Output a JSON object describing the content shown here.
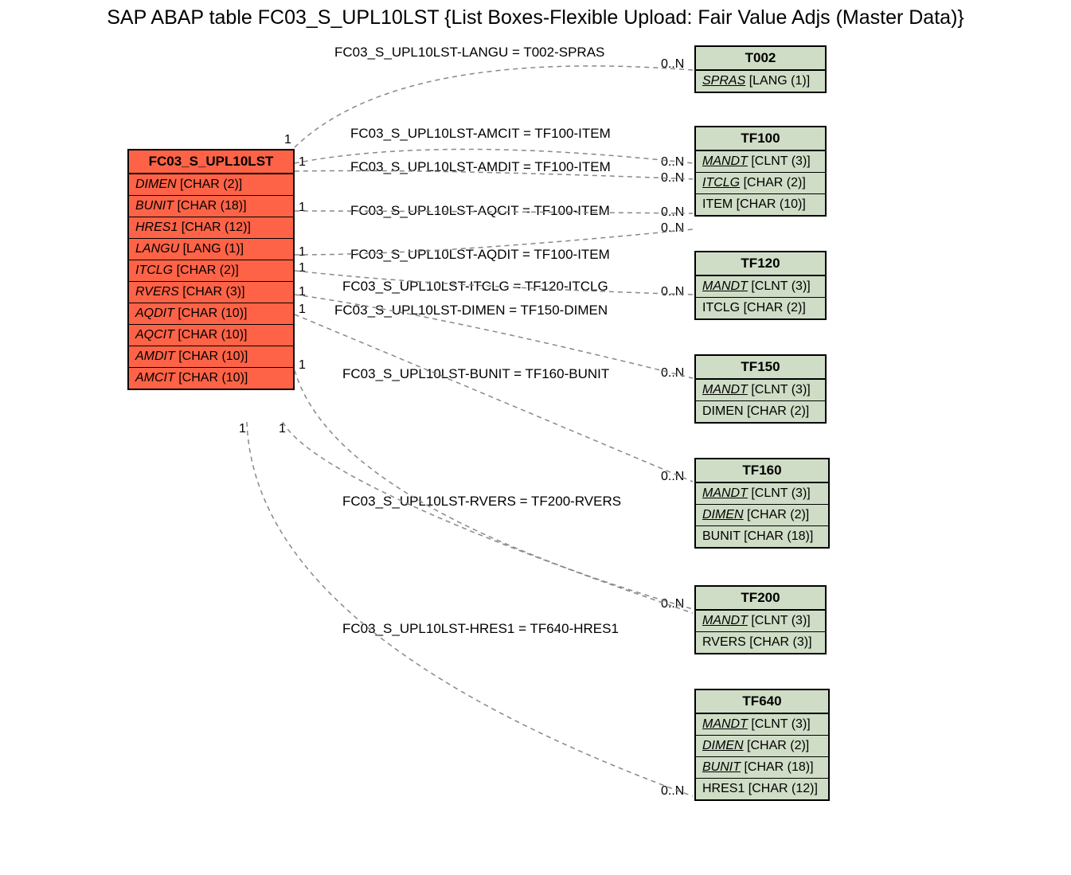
{
  "title": "SAP ABAP table FC03_S_UPL10LST {List Boxes-Flexible Upload: Fair Value Adjs (Master Data)}",
  "main": {
    "name": "FC03_S_UPL10LST",
    "fields": [
      {
        "name": "DIMEN",
        "type": "CHAR (2)"
      },
      {
        "name": "BUNIT",
        "type": "CHAR (18)"
      },
      {
        "name": "HRES1",
        "type": "CHAR (12)"
      },
      {
        "name": "LANGU",
        "type": "LANG (1)"
      },
      {
        "name": "ITCLG",
        "type": "CHAR (2)"
      },
      {
        "name": "RVERS",
        "type": "CHAR (3)"
      },
      {
        "name": "AQDIT",
        "type": "CHAR (10)"
      },
      {
        "name": "AQCIT",
        "type": "CHAR (10)"
      },
      {
        "name": "AMDIT",
        "type": "CHAR (10)"
      },
      {
        "name": "AMCIT",
        "type": "CHAR (10)"
      }
    ]
  },
  "refs": [
    {
      "name": "T002",
      "fields": [
        {
          "name": "SPRAS",
          "type": "LANG (1)",
          "fk": true
        }
      ]
    },
    {
      "name": "TF100",
      "fields": [
        {
          "name": "MANDT",
          "type": "CLNT (3)",
          "fk": true
        },
        {
          "name": "ITCLG",
          "type": "CHAR (2)",
          "fk": true
        },
        {
          "name": "ITEM",
          "type": "CHAR (10)"
        }
      ]
    },
    {
      "name": "TF120",
      "fields": [
        {
          "name": "MANDT",
          "type": "CLNT (3)",
          "fk": true
        },
        {
          "name": "ITCLG",
          "type": "CHAR (2)"
        }
      ]
    },
    {
      "name": "TF150",
      "fields": [
        {
          "name": "MANDT",
          "type": "CLNT (3)",
          "fk": true
        },
        {
          "name": "DIMEN",
          "type": "CHAR (2)"
        }
      ]
    },
    {
      "name": "TF160",
      "fields": [
        {
          "name": "MANDT",
          "type": "CLNT (3)",
          "fk": true
        },
        {
          "name": "DIMEN",
          "type": "CHAR (2)",
          "fk": true
        },
        {
          "name": "BUNIT",
          "type": "CHAR (18)"
        }
      ]
    },
    {
      "name": "TF200",
      "fields": [
        {
          "name": "MANDT",
          "type": "CLNT (3)",
          "fk": true
        },
        {
          "name": "RVERS",
          "type": "CHAR (3)"
        }
      ]
    },
    {
      "name": "TF640",
      "fields": [
        {
          "name": "MANDT",
          "type": "CLNT (3)",
          "fk": true
        },
        {
          "name": "DIMEN",
          "type": "CHAR (2)",
          "fk": true
        },
        {
          "name": "BUNIT",
          "type": "CHAR (18)",
          "fk": true
        },
        {
          "name": "HRES1",
          "type": "CHAR (12)"
        }
      ]
    }
  ],
  "edges": [
    {
      "label": "FC03_S_UPL10LST-LANGU = T002-SPRAS",
      "left_card": "1",
      "right_card": "0..N"
    },
    {
      "label": "FC03_S_UPL10LST-AMCIT = TF100-ITEM",
      "left_card": "1",
      "right_card": "0..N"
    },
    {
      "label": "FC03_S_UPL10LST-AMDIT = TF100-ITEM",
      "left_card": "1",
      "right_card": "0..N"
    },
    {
      "label": "FC03_S_UPL10LST-AQCIT = TF100-ITEM",
      "left_card": "1",
      "right_card": "0..N"
    },
    {
      "label": "FC03_S_UPL10LST-AQDIT = TF100-ITEM",
      "left_card": "1",
      "right_card": "0..N"
    },
    {
      "label": "FC03_S_UPL10LST-ITCLG = TF120-ITCLG",
      "left_card": "1",
      "right_card": "0..N"
    },
    {
      "label": "FC03_S_UPL10LST-DIMEN = TF150-DIMEN",
      "left_card": "1",
      "right_card": "0..N"
    },
    {
      "label": "FC03_S_UPL10LST-BUNIT = TF160-BUNIT",
      "left_card": "1",
      "right_card": "0..N"
    },
    {
      "label": "FC03_S_UPL10LST-RVERS = TF200-RVERS",
      "left_card": "1",
      "right_card": "0..N"
    },
    {
      "label": "FC03_S_UPL10LST-HRES1 = TF640-HRES1",
      "left_card": "1",
      "right_card": "0..N"
    }
  ],
  "cards_right": "0..N",
  "cards_left": "1"
}
